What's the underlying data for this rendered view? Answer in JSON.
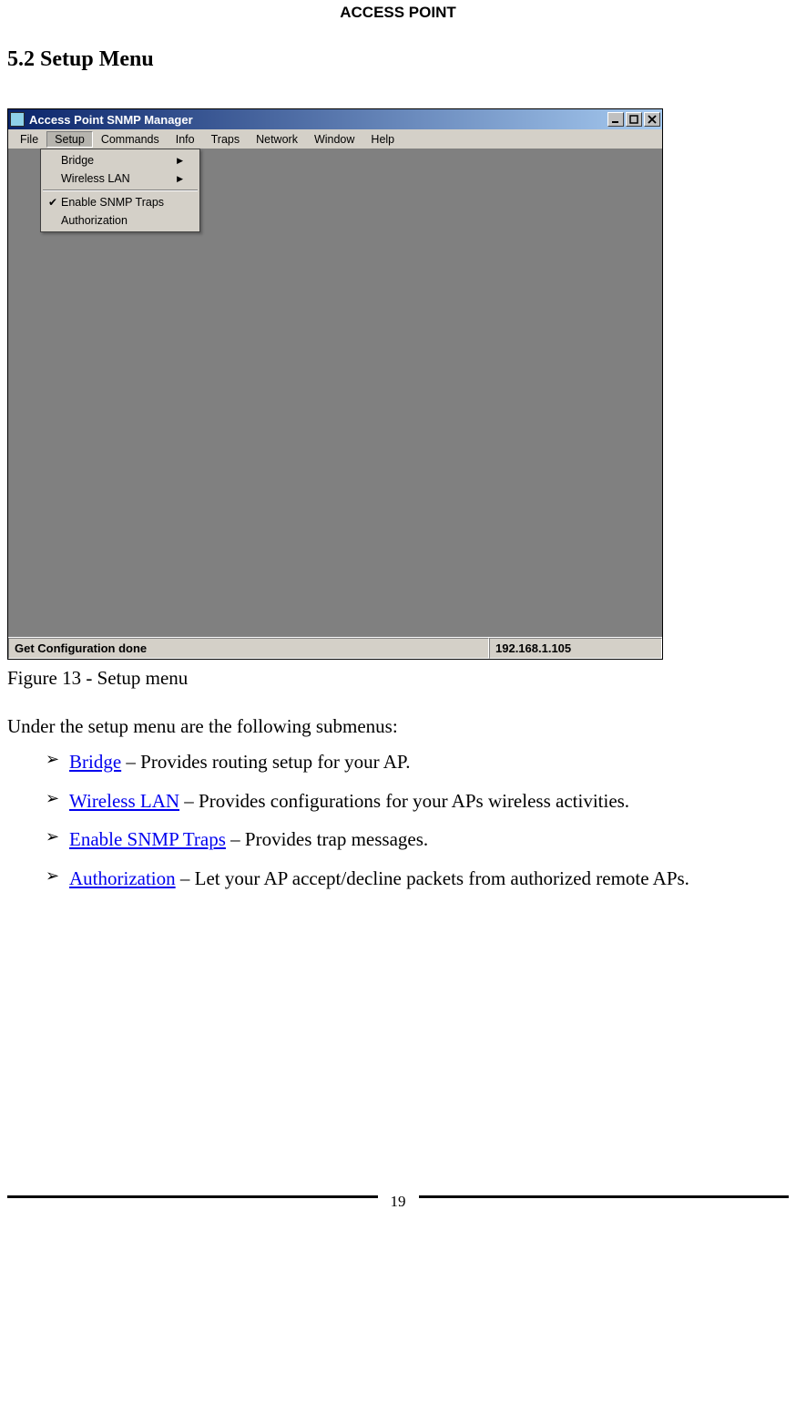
{
  "doc": {
    "header": "ACCESS POINT",
    "section_heading": "5.2 Setup Menu",
    "caption": "Figure 13 - Setup menu",
    "intro": "Under the setup menu are the following submenus:",
    "bullets": [
      {
        "link": "Bridge",
        "rest": " – Provides routing setup for your AP."
      },
      {
        "link": "Wireless LAN",
        "rest": " – Provides configurations for your APs wireless activities."
      },
      {
        "link": "Enable SNMP Traps",
        "rest": " – Provides trap messages."
      },
      {
        "link": "Authorization",
        "rest": " – Let your AP accept/decline packets from authorized remote APs."
      }
    ],
    "page_number": "19"
  },
  "app": {
    "title": "Access Point SNMP Manager",
    "menubar": [
      "File",
      "Setup",
      "Commands",
      "Info",
      "Traps",
      "Network",
      "Window",
      "Help"
    ],
    "active_menu_index": 1,
    "dropdown": {
      "items": [
        {
          "label": "Bridge",
          "submenu": true,
          "checked": false
        },
        {
          "label": "Wireless LAN",
          "submenu": true,
          "checked": false
        }
      ],
      "items2": [
        {
          "label": "Enable SNMP Traps",
          "submenu": false,
          "checked": true
        },
        {
          "label": "Authorization",
          "submenu": false,
          "checked": false
        }
      ]
    },
    "status_left": "Get Configuration done",
    "status_right": "192.168.1.105"
  }
}
